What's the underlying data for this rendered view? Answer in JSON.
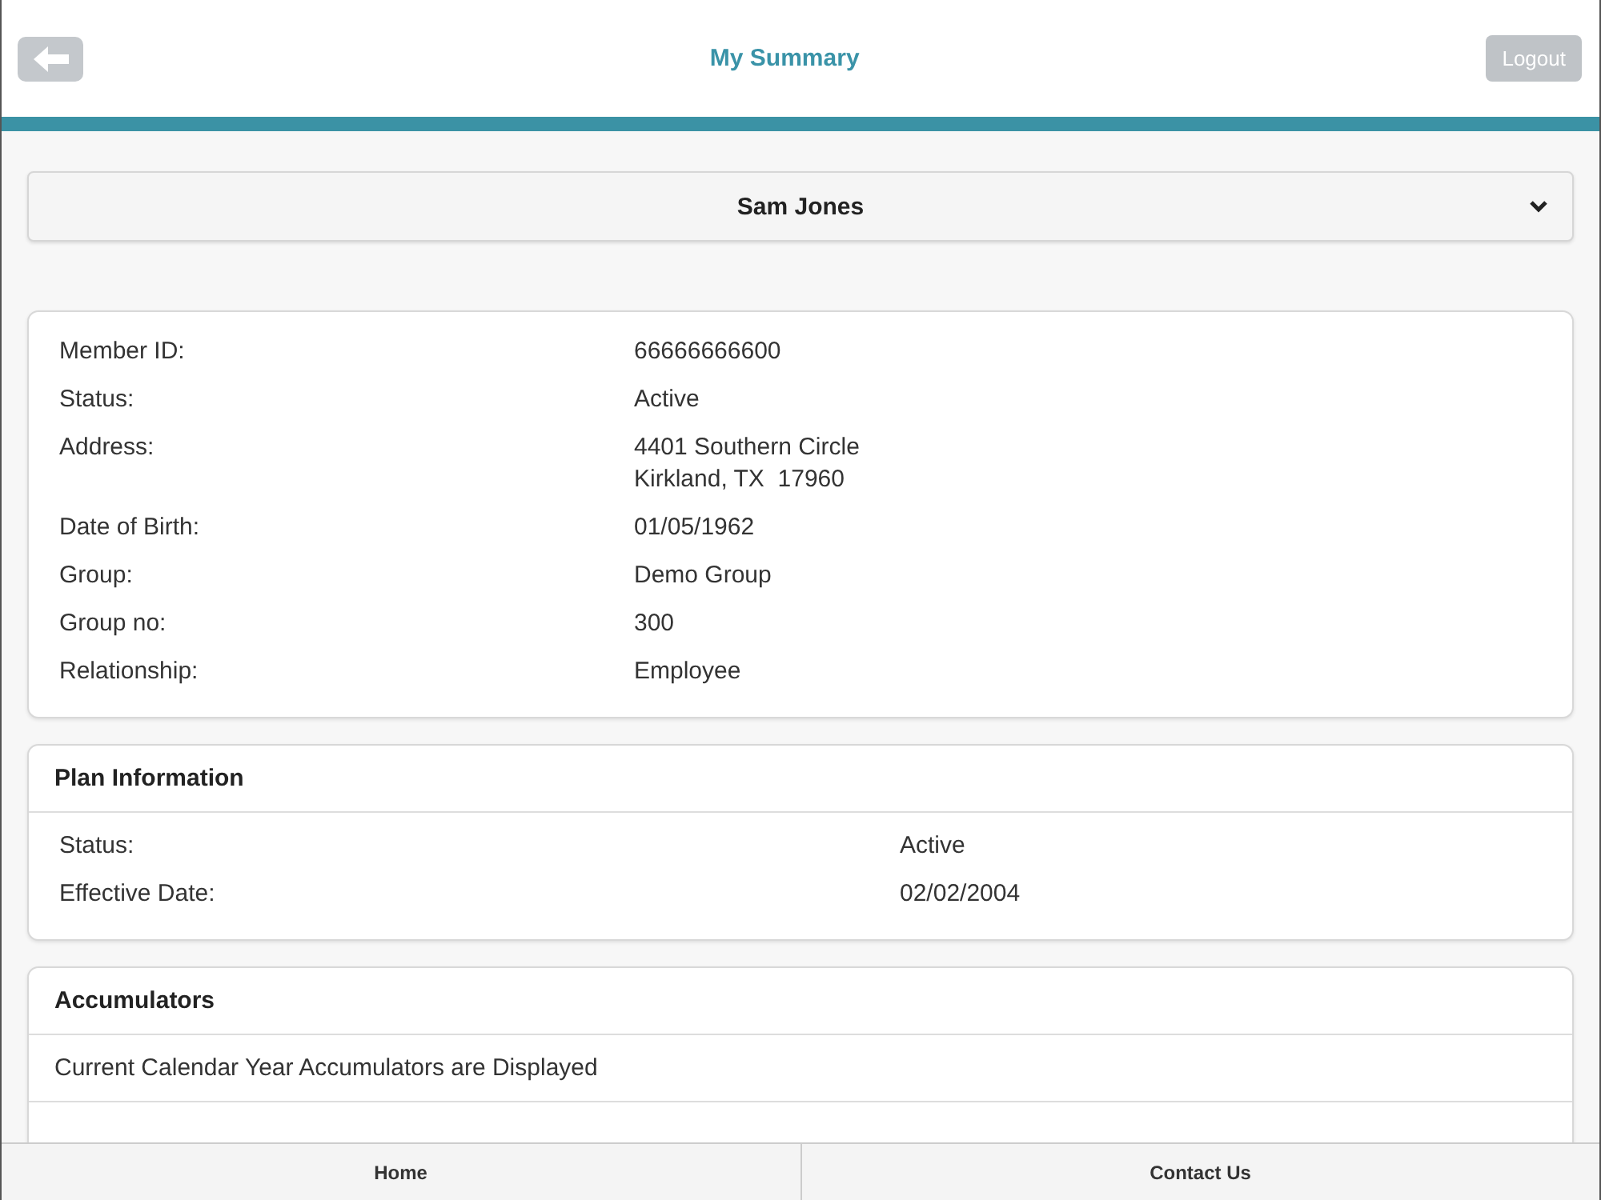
{
  "header": {
    "title": "My Summary",
    "logout": "Logout"
  },
  "member_selector": {
    "name": "Sam Jones"
  },
  "member_details": [
    {
      "label": "Member ID:",
      "value": [
        "66666666600"
      ]
    },
    {
      "label": "Status:",
      "value": [
        "Active"
      ]
    },
    {
      "label": "Address:",
      "value": [
        "4401 Southern Circle",
        "Kirkland, TX  17960"
      ]
    },
    {
      "label": "Date of Birth:",
      "value": [
        "01/05/1962"
      ]
    },
    {
      "label": "Group:",
      "value": [
        "Demo Group"
      ]
    },
    {
      "label": "Group no:",
      "value": [
        "300"
      ]
    },
    {
      "label": "Relationship:",
      "value": [
        "Employee"
      ]
    }
  ],
  "plan_information": {
    "title": "Plan Information",
    "rows": [
      {
        "label": "Status:",
        "value": "Active"
      },
      {
        "label": "Effective Date:",
        "value": "02/02/2004"
      }
    ]
  },
  "accumulators": {
    "title": "Accumulators",
    "note": "Current Calendar Year Accumulators are Displayed"
  },
  "footer_tabs": [
    {
      "label": "Home"
    },
    {
      "label": "Contact Us"
    }
  ]
}
